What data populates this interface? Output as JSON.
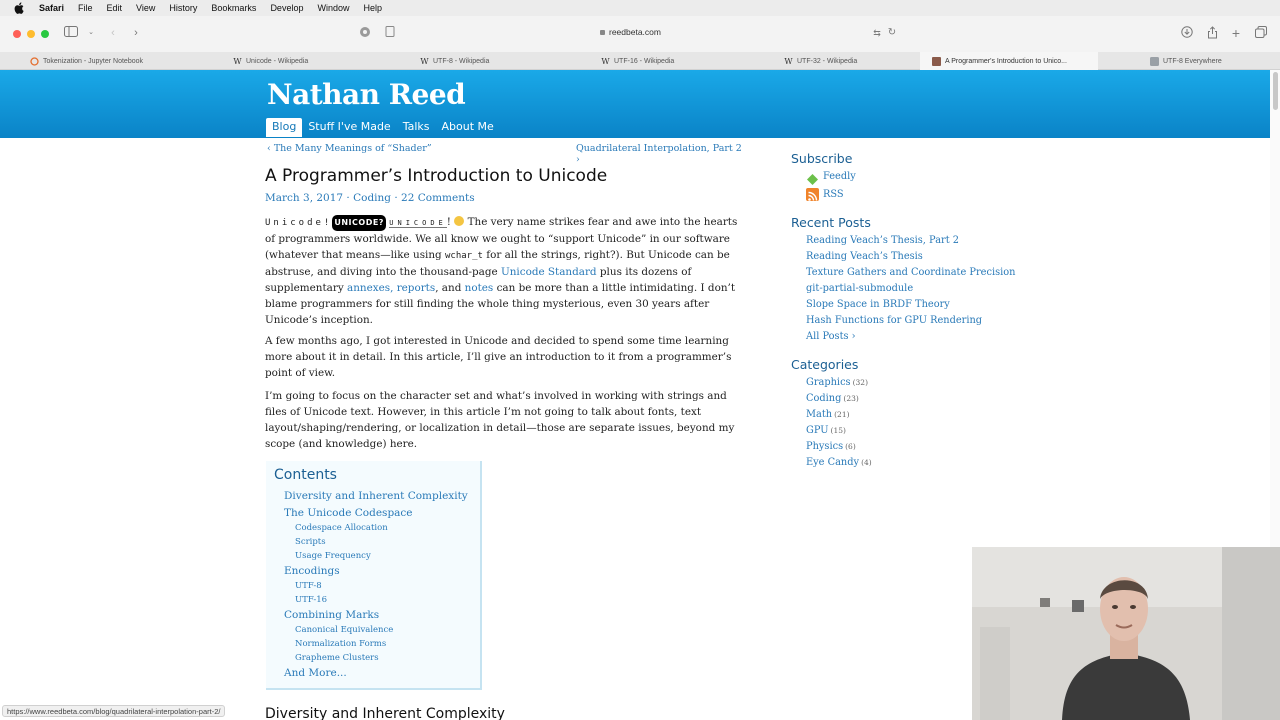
{
  "menubar": {
    "items": [
      "Safari",
      "File",
      "Edit",
      "View",
      "History",
      "Bookmarks",
      "Develop",
      "Window",
      "Help"
    ]
  },
  "toolbar": {
    "url": "reedbeta.com"
  },
  "tabs": [
    {
      "label": "Tokenization - Jupyter Notebook",
      "favicon": "jupyter-icon"
    },
    {
      "label": "Unicode - Wikipedia",
      "favicon": "wikipedia-icon"
    },
    {
      "label": "UTF-8 - Wikipedia",
      "favicon": "wikipedia-icon"
    },
    {
      "label": "UTF-16 - Wikipedia",
      "favicon": "wikipedia-icon"
    },
    {
      "label": "UTF-32 - Wikipedia",
      "favicon": "wikipedia-icon"
    },
    {
      "label": "A Programmer's Introduction to Unico...",
      "favicon": "site-icon"
    },
    {
      "label": "UTF-8 Everywhere",
      "favicon": "site-icon"
    }
  ],
  "site": {
    "title": "Nathan Reed",
    "nav": [
      "Blog",
      "Stuff I've Made",
      "Talks",
      "About Me"
    ]
  },
  "post": {
    "prev": "The Many Meanings of “Shader”",
    "next": "Quadrilateral Interpolation, Part 2",
    "title": "A Programmer’s Introduction to Unicode",
    "date": "March 3, 2017",
    "category": "Coding",
    "comments": "22 Comments",
    "p1": {
      "u1": "Unicode!",
      "u2": "UNICODE?",
      "u3": "UNICODE",
      "t1": "!",
      "t2": " The very name strikes fear and awe into the hearts of programmers worldwide. We all know we ought to “support Unicode” in our software (whatever that means—like using ",
      "code": "wchar_t",
      "t3": " for all the strings, right?). But Unicode can be abstruse, and diving into the thousand-page ",
      "link1": "Unicode Standard",
      "t4": " plus its dozens of supplementary ",
      "link2": "annexes, reports",
      "t5": ", and ",
      "link3": "notes",
      "t6": " can be more than a little intimidating. I don’t blame programmers for still finding the whole thing mysterious, even 30 years after Unicode’s inception."
    },
    "p2": "A few months ago, I got interested in Unicode and decided to spend some time learning more about it in detail. In this article, I’ll give an introduction to it from a programmer’s point of view.",
    "p3": "I’m going to focus on the character set and what’s involved in working with strings and files of Unicode text. However, in this article I’m not going to talk about fonts, text layout/shaping/rendering, or localization in detail—those are separate issues, beyond my scope (and knowledge) here.",
    "next_heading": "Diversity and Inherent Complexity"
  },
  "contents": {
    "title": "Contents",
    "items": [
      {
        "label": "Diversity and Inherent Complexity",
        "level": 1
      },
      {
        "label": "The Unicode Codespace",
        "level": 1
      },
      {
        "label": "Codespace Allocation",
        "level": 2
      },
      {
        "label": "Scripts",
        "level": 2
      },
      {
        "label": "Usage Frequency",
        "level": 2
      },
      {
        "label": "Encodings",
        "level": 1
      },
      {
        "label": "UTF-8",
        "level": 2
      },
      {
        "label": "UTF-16",
        "level": 2
      },
      {
        "label": "Combining Marks",
        "level": 1
      },
      {
        "label": "Canonical Equivalence",
        "level": 2
      },
      {
        "label": "Normalization Forms",
        "level": 2
      },
      {
        "label": "Grapheme Clusters",
        "level": 2
      },
      {
        "label": "And More...",
        "level": 1
      }
    ]
  },
  "sidebar": {
    "subscribe_title": "Subscribe",
    "feeds": [
      "Feedly",
      "RSS"
    ],
    "recent_title": "Recent Posts",
    "recent": [
      "Reading Veach’s Thesis, Part 2",
      "Reading Veach’s Thesis",
      "Texture Gathers and Coordinate Precision",
      "git-partial-submodule",
      "Slope Space in BRDF Theory",
      "Hash Functions for GPU Rendering"
    ],
    "all_posts": "All Posts",
    "categories_title": "Categories",
    "categories": [
      {
        "name": "Graphics",
        "count": "(32)"
      },
      {
        "name": "Coding",
        "count": "(23)"
      },
      {
        "name": "Math",
        "count": "(21)"
      },
      {
        "name": "GPU",
        "count": "(15)"
      },
      {
        "name": "Physics",
        "count": "(6)"
      },
      {
        "name": "Eye Candy",
        "count": "(4)"
      }
    ]
  },
  "statusbar": "https://www.reedbeta.com/blog/quadrilateral-interpolation-part-2/",
  "colors": {
    "header_top": "#1aa9e8",
    "header_bottom": "#0a83c7",
    "link": "#2a7ab8",
    "heading": "#1b5f93"
  }
}
